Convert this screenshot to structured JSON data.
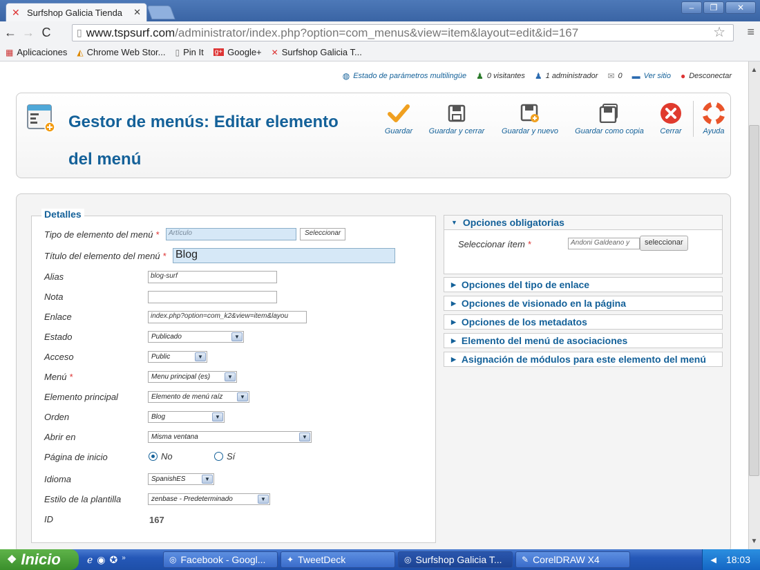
{
  "browser": {
    "tab_title": "Surfshop Galicia Tienda",
    "url_host": "www.tspsurf.com",
    "url_path": "/administrator/index.php?option=com_menus&view=item&layout=edit&id=167",
    "bookmarks": [
      "Aplicaciones",
      "Chrome Web Stor...",
      "Pin It",
      "Google+",
      "Surfshop Galicia T..."
    ]
  },
  "status": {
    "multilang": "Estado de parámetros multilingüe",
    "visitors": "0 visitantes",
    "admins": "1 administrador",
    "messages": "0",
    "view_site": "Ver sitio",
    "logout": "Desconectar"
  },
  "header": {
    "title": "Gestor de menús: Editar elemento del menú",
    "buttons": [
      "Guardar",
      "Guardar y cerrar",
      "Guardar y nuevo",
      "Guardar como copia",
      "Cerrar",
      "Ayuda"
    ]
  },
  "details": {
    "legend": "Detalles",
    "labels": {
      "type": "Tipo de elemento del menú",
      "title": "Título del elemento del menú",
      "alias": "Alias",
      "note": "Nota",
      "link": "Enlace",
      "state": "Estado",
      "access": "Acceso",
      "menu": "Menú",
      "parent": "Elemento principal",
      "order": "Orden",
      "open_in": "Abrir en",
      "home": "Página de inicio",
      "language": "Idioma",
      "template": "Estilo de la plantilla",
      "id": "ID"
    },
    "values": {
      "type": "Artículo",
      "select_button": "Seleccionar",
      "title": "Blog",
      "alias": "blog-surf",
      "note": "",
      "link": "index.php?option=com_k2&view=item&layou",
      "state": "Publicado",
      "access": "Public",
      "menu": "Menu principal (es)",
      "parent": "Elemento de menú raíz",
      "order": "Blog",
      "open_in": "Misma ventana",
      "home_no": "No",
      "home_yes": "Sí",
      "home_selected": "No",
      "language": "SpanishES",
      "template": "zenbase - Predeterminado",
      "id": "167"
    }
  },
  "options": {
    "required_title": "Opciones obligatorias",
    "select_item_label": "Seleccionar ítem",
    "select_item_value": "Andoni Galdeano y",
    "select_item_button": "seleccionar",
    "sections": [
      "Opciones del tipo de enlace",
      "Opciones de visionado en la página",
      "Opciones de los metadatos",
      "Elemento del menú de asociaciones",
      "Asignación de módulos para este elemento del menú"
    ]
  },
  "taskbar": {
    "start": "Inicio",
    "tasks": [
      "Facebook - Googl...",
      "TweetDeck",
      "Surfshop Galicia T...",
      "CorelDRAW X4"
    ],
    "active_task": "Surfshop Galicia T...",
    "clock": "18:03"
  },
  "colors": {
    "accent": "#146199",
    "required": "#d33333",
    "field_highlight": "#d6e8f7"
  }
}
